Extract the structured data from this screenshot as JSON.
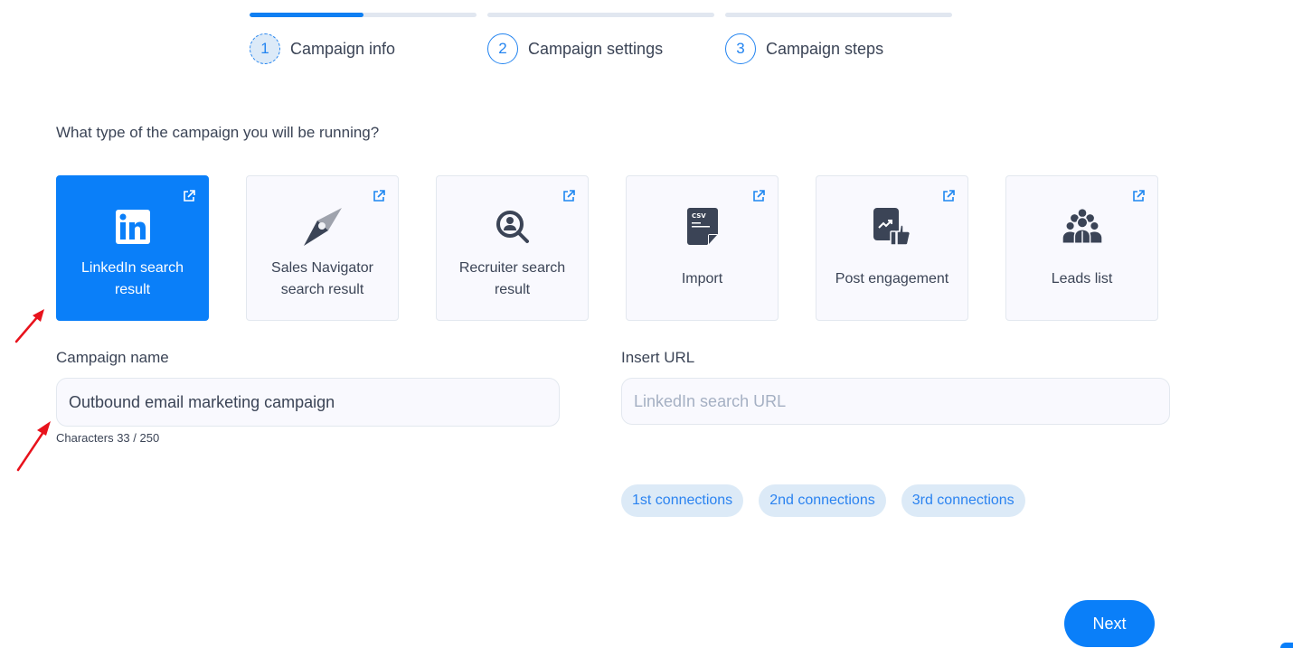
{
  "stepper": {
    "progress": 0.5,
    "steps": [
      {
        "number": "1",
        "label": "Campaign info",
        "active": true
      },
      {
        "number": "2",
        "label": "Campaign settings",
        "active": false
      },
      {
        "number": "3",
        "label": "Campaign steps",
        "active": false
      }
    ]
  },
  "question": "What type of the campaign you will be running?",
  "campaign_types": [
    {
      "label": "LinkedIn search result",
      "icon": "linkedin-icon",
      "selected": true
    },
    {
      "label": "Sales Navigator search result",
      "icon": "compass-icon",
      "selected": false
    },
    {
      "label": "Recruiter search result",
      "icon": "person-search-icon",
      "selected": false
    },
    {
      "label": "Import",
      "icon": "csv-file-icon",
      "selected": false
    },
    {
      "label": "Post engagement",
      "icon": "post-like-icon",
      "selected": false
    },
    {
      "label": "Leads list",
      "icon": "group-icon",
      "selected": false
    }
  ],
  "campaign_name": {
    "label": "Campaign name",
    "value": "Outbound email marketing campaign",
    "char_count": "Characters 33 / 250"
  },
  "insert_url": {
    "label": "Insert URL",
    "value": "",
    "placeholder": "LinkedIn search URL"
  },
  "connection_chips": [
    "1st connections",
    "2nd connections",
    "3rd connections"
  ],
  "next_button": "Next",
  "colors": {
    "accent": "#0a7ff9",
    "chip_bg": "#dceaf7",
    "text": "#3b4456",
    "annotation_arrow": "#e8121c"
  }
}
